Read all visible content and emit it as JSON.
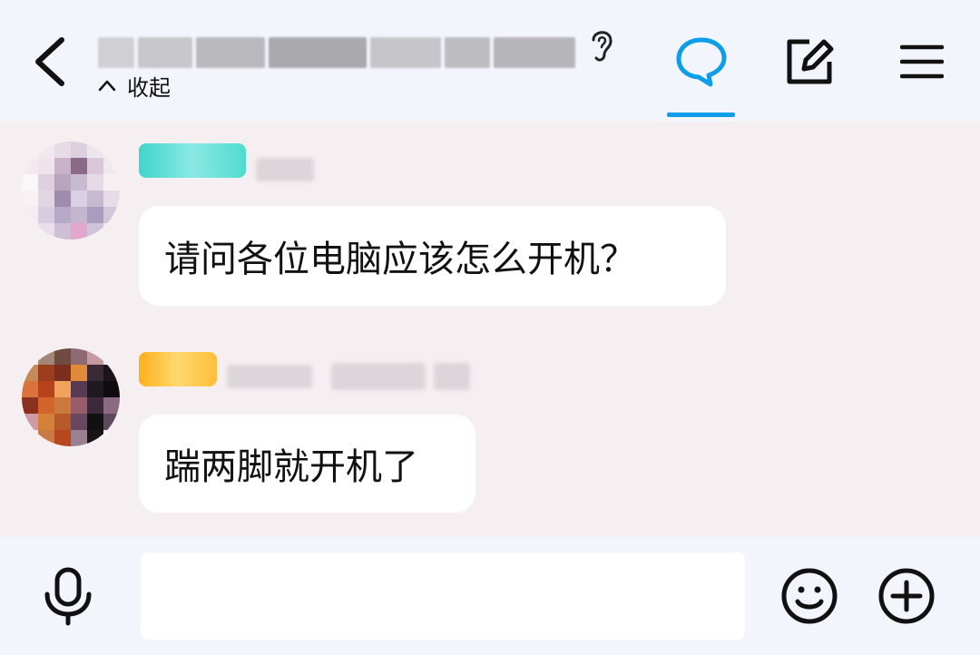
{
  "header": {
    "back_icon": "chevron-left-icon",
    "collapse_label": "收起",
    "tabs": [
      "chat-bubble-icon",
      "edit-icon",
      "menu-icon"
    ],
    "accent_color": "#0d9de9"
  },
  "messages": [
    {
      "badge_color": "#3dd9cc",
      "text": "请问各位电脑应该怎么开机？"
    },
    {
      "badge_color": "#ffb21e",
      "text": "踹两脚就开机了"
    }
  ],
  "composer": {
    "placeholder": "",
    "icons": [
      "microphone-icon",
      "emoji-icon",
      "plus-icon"
    ]
  }
}
